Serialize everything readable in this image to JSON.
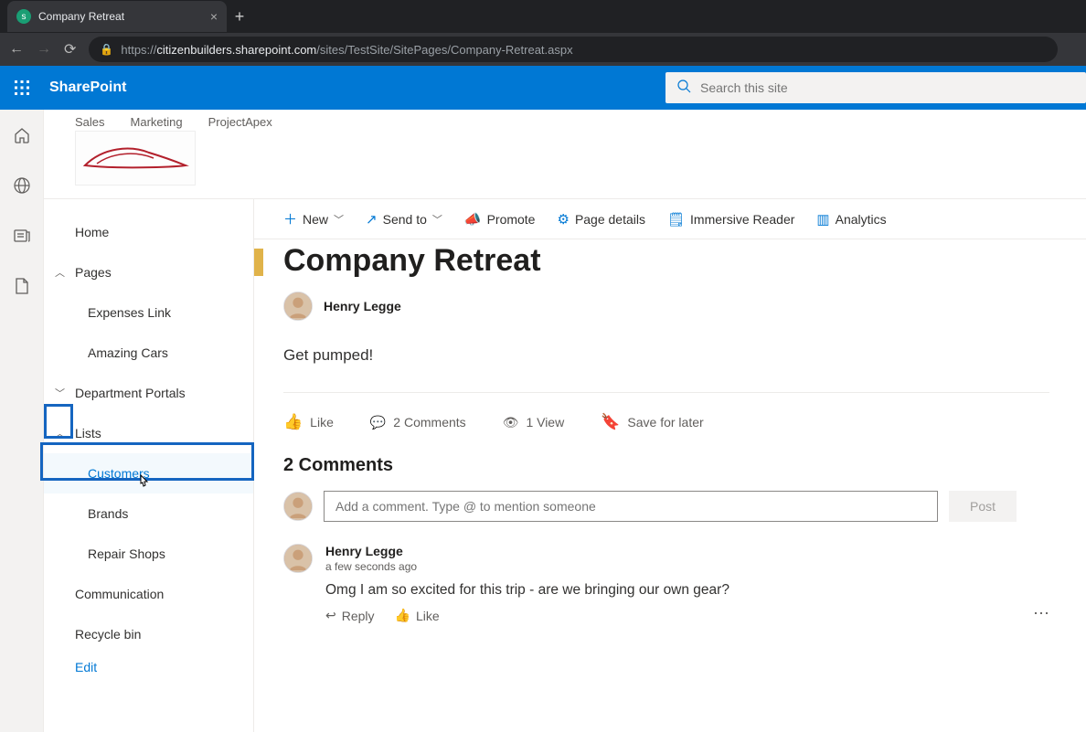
{
  "browser": {
    "tab_title": "Company Retreat",
    "url_prefix": "https://",
    "url_host": "citizenbuilders.sharepoint.com",
    "url_path": "/sites/TestSite/SitePages/Company-Retreat.aspx"
  },
  "header": {
    "app_name": "SharePoint",
    "search_placeholder": "Search this site"
  },
  "hub_links": [
    "Sales",
    "Marketing",
    "ProjectApex"
  ],
  "nav": {
    "home": "Home",
    "pages": "Pages",
    "pages_children": [
      "Expenses Link",
      "Amazing Cars"
    ],
    "department_portals": "Department Portals",
    "lists": "Lists",
    "lists_children": [
      "Customers",
      "Brands",
      "Repair Shops"
    ],
    "communication": "Communication",
    "recycle_bin": "Recycle bin",
    "edit": "Edit"
  },
  "commands": {
    "new": "New",
    "send_to": "Send to",
    "promote": "Promote",
    "page_details": "Page details",
    "immersive_reader": "Immersive Reader",
    "analytics": "Analytics"
  },
  "page": {
    "title": "Company Retreat",
    "author": "Henry Legge",
    "body_text": "Get pumped!",
    "like_label": "Like",
    "comments_count_label": "2 Comments",
    "views_label": "1 View",
    "save_label": "Save for later",
    "comments_heading": "2 Comments",
    "comment_placeholder": "Add a comment. Type @ to mention someone",
    "post_label": "Post"
  },
  "comments": [
    {
      "author": "Henry Legge",
      "time": "a few seconds ago",
      "text": "Omg I am so excited for this trip - are we bringing our own gear?",
      "reply_label": "Reply",
      "like_label": "Like"
    }
  ]
}
